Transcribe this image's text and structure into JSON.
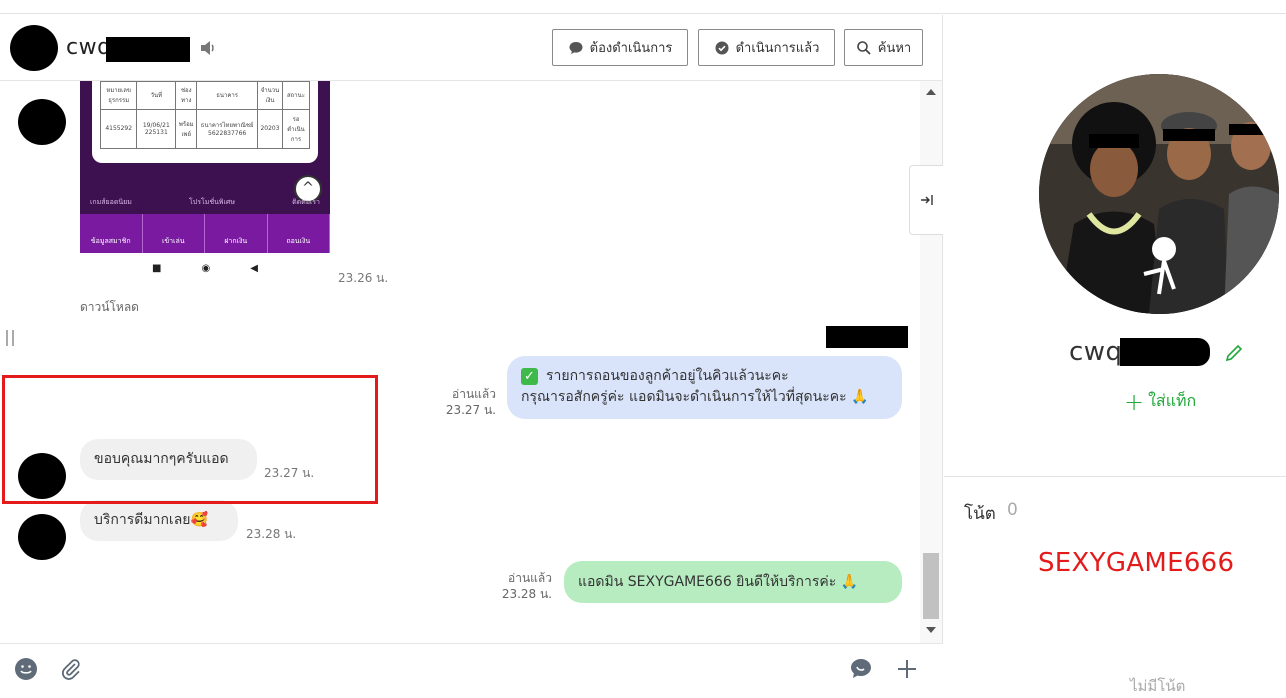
{
  "header": {
    "contact_name": "cwq",
    "buttons": {
      "todo": "ต้องดำเนินการ",
      "done": "ดำเนินการแล้ว",
      "search": "ค้นหา"
    }
  },
  "messages": {
    "image_time": "23.26 น.",
    "download_label": "ดาวน์โหลด",
    "image_table": [
      [
        "หมายเลขธุรกรรม",
        "วันที่",
        "ช่องทาง",
        "ธนาคาร",
        "จำนวนเงิน",
        "สถานะ"
      ],
      [
        "4155292",
        "19/06/21 225131",
        "พร้อมเพย์",
        "ธนาคารไทยพาณิชย์ 5622837766",
        "20203",
        "รอดำเนินการ"
      ]
    ],
    "image_bar": [
      "ข้อมูลสมาชิก",
      "เข้าเล่น",
      "ฝากเงิน",
      "ถอนเงิน"
    ],
    "image_mid": [
      "เกมส์ยอดนิยม",
      "โปรโมชั่นพิเศษ",
      "ติดต่อเรา"
    ],
    "out1_line1": "รายการถอนของลูกค้าอยู่ในคิวแล้วนะคะ",
    "out1_line2": "กรุณารอสักครู่ค่ะ แอดมินจะดำเนินการให้ไวที่สุดนะคะ 🙏",
    "out1_read": "อ่านแล้ว",
    "out1_time": "23.27 น.",
    "in1_text": "ขอบคุณมากๆครับแอด",
    "in1_time": "23.27 น.",
    "in2_text": "บริการดีมากเลย🥰",
    "in2_time": "23.28 น.",
    "out2_text": "แอดมิน SEXYGAME666 ยินดีให้บริการค่ะ 🙏",
    "out2_read": "อ่านแล้ว",
    "out2_time": "23.28 น."
  },
  "profile": {
    "name": "cwq",
    "add_tag": "ใส่แท็ก",
    "note_label": "โน้ต",
    "note_count": "0",
    "note_text": "SEXYGAME666",
    "no_note": "ไม่มีโน้ต"
  },
  "colors": {
    "outgoing_bubble": "#d9e4fa",
    "incoming_bubble": "#f0f0f0",
    "green_bubble": "#b7ecc0",
    "accent_green": "#22a83a",
    "highlight_red": "#e31b1b"
  },
  "icons": {
    "speaker": "speaker-icon",
    "todo": "speech-bubble-icon",
    "done": "check-bubble-icon",
    "search": "search-icon",
    "collapse": "collapse-panel-icon",
    "emoji": "emoji-icon",
    "attach": "paperclip-icon",
    "chat": "chat-icon",
    "plus": "plus-icon",
    "edit": "pencil-icon"
  }
}
